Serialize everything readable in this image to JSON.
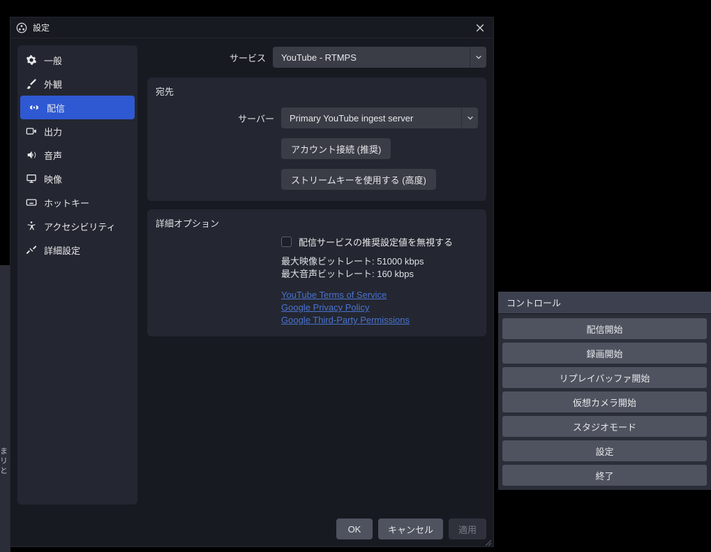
{
  "dialog": {
    "title": "設定"
  },
  "sidebar": {
    "items": [
      {
        "label": "一般"
      },
      {
        "label": "外観"
      },
      {
        "label": "配信"
      },
      {
        "label": "出力"
      },
      {
        "label": "音声"
      },
      {
        "label": "映像"
      },
      {
        "label": "ホットキー"
      },
      {
        "label": "アクセシビリティ"
      },
      {
        "label": "詳細設定"
      }
    ]
  },
  "content": {
    "service_label": "サービス",
    "service_value": "YouTube - RTMPS",
    "destination_title": "宛先",
    "server_label": "サーバー",
    "server_value": "Primary YouTube ingest server",
    "connect_account_btn": "アカウント接続 (推奨)",
    "use_streamkey_btn": "ストリームキーを使用する (高度)",
    "advanced_title": "詳細オプション",
    "ignore_recommended_label": "配信サービスの推奨設定値を無視する",
    "max_video_bitrate": "最大映像ビットレート: 51000 kbps",
    "max_audio_bitrate": "最大音声ビットレート: 160 kbps",
    "links": {
      "tos": "YouTube Terms of Service",
      "privacy": "Google Privacy Policy",
      "third_party": "Google Third-Party Permissions"
    }
  },
  "footer": {
    "ok": "OK",
    "cancel": "キャンセル",
    "apply": "適用"
  },
  "bg_controls": {
    "title": "コントロール",
    "buttons": [
      "配信開始",
      "録画開始",
      "リプレイバッファ開始",
      "仮想カメラ開始",
      "スタジオモード",
      "設定",
      "終了"
    ]
  }
}
